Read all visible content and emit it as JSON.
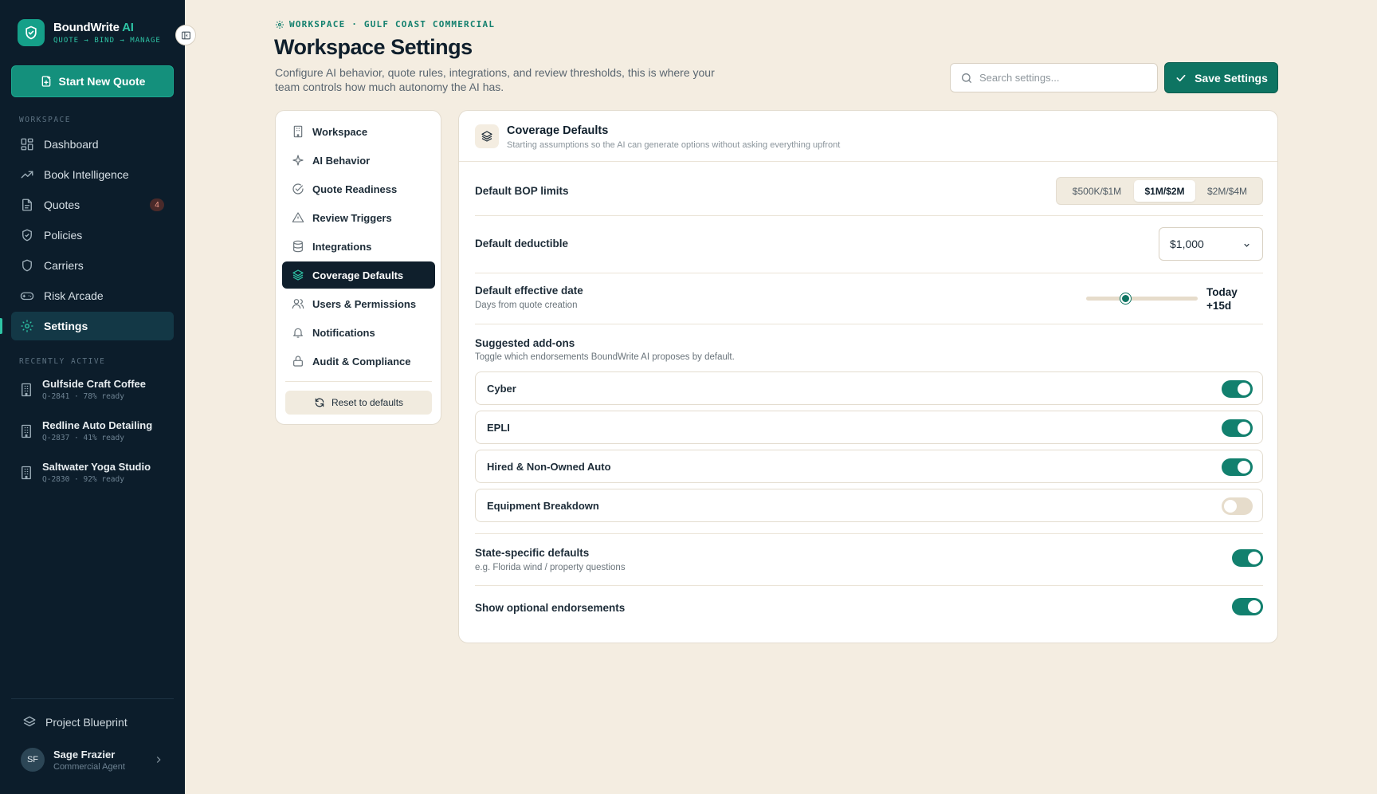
{
  "brand": {
    "name": "BoundWrite",
    "ai": "AI",
    "tagline": "QUOTE → BIND → MANAGE"
  },
  "sidebar": {
    "new_quote": "Start New Quote",
    "workspace_label": "WORKSPACE",
    "items": [
      {
        "label": "Dashboard",
        "icon": "dashboard-icon"
      },
      {
        "label": "Book Intelligence",
        "icon": "trend-icon"
      },
      {
        "label": "Quotes",
        "icon": "document-icon",
        "badge": "4"
      },
      {
        "label": "Policies",
        "icon": "shield-icon"
      },
      {
        "label": "Carriers",
        "icon": "shield-icon"
      },
      {
        "label": "Risk Arcade",
        "icon": "gamepad-icon"
      },
      {
        "label": "Settings",
        "icon": "gear-icon",
        "active": true
      }
    ],
    "recent_label": "RECENTLY ACTIVE",
    "recent": [
      {
        "name": "Gulfside Craft Coffee",
        "meta": "Q-2841 · 78% ready"
      },
      {
        "name": "Redline Auto Detailing",
        "meta": "Q-2837 · 41% ready"
      },
      {
        "name": "Saltwater Yoga Studio",
        "meta": "Q-2830 · 92% ready"
      }
    ],
    "blueprint": "Project Blueprint",
    "user": {
      "initials": "SF",
      "name": "Sage Frazier",
      "role": "Commercial Agent"
    }
  },
  "header": {
    "breadcrumb": "WORKSPACE · GULF COAST COMMERCIAL",
    "title": "Workspace Settings",
    "subtitle": "Configure AI behavior, quote rules, integrations, and review thresholds, this is where your team controls how much autonomy the AI has.",
    "search_placeholder": "Search settings...",
    "save": "Save Settings"
  },
  "menu": {
    "items": [
      {
        "label": "Workspace",
        "icon": "building-icon"
      },
      {
        "label": "AI Behavior",
        "icon": "sparkle-icon"
      },
      {
        "label": "Quote Readiness",
        "icon": "check-circle-icon"
      },
      {
        "label": "Review Triggers",
        "icon": "warning-icon"
      },
      {
        "label": "Integrations",
        "icon": "database-icon"
      },
      {
        "label": "Coverage Defaults",
        "icon": "layers-icon",
        "active": true
      },
      {
        "label": "Users & Permissions",
        "icon": "users-icon"
      },
      {
        "label": "Notifications",
        "icon": "bell-icon"
      },
      {
        "label": "Audit & Compliance",
        "icon": "lock-icon"
      }
    ],
    "reset": "Reset to defaults"
  },
  "panel": {
    "title": "Coverage Defaults",
    "subtitle": "Starting assumptions so the AI can generate options without asking everything upfront",
    "bop": {
      "label": "Default BOP limits",
      "options": [
        "$500K/$1M",
        "$1M/$2M",
        "$2M/$4M"
      ],
      "selected": "$1M/$2M"
    },
    "deductible": {
      "label": "Default deductible",
      "value": "$1,000"
    },
    "effective_date": {
      "label": "Default effective date",
      "hint": "Days from quote creation",
      "value_line1": "Today",
      "value_line2": "+15d",
      "slider_fraction": 0.35
    },
    "addons": {
      "label": "Suggested add-ons",
      "hint": "Toggle which endorsements BoundWrite AI proposes by default.",
      "items": [
        {
          "label": "Cyber",
          "on": true
        },
        {
          "label": "EPLI",
          "on": true
        },
        {
          "label": "Hired & Non-Owned Auto",
          "on": true
        },
        {
          "label": "Equipment Breakdown",
          "on": false
        }
      ]
    },
    "state_defaults": {
      "label": "State-specific defaults",
      "hint": "e.g. Florida wind / property questions",
      "on": true
    },
    "optional_endorsements": {
      "label": "Show optional endorsements",
      "on": true
    }
  },
  "colors": {
    "accent": "#12806e",
    "sidebar": "#0c1d2b",
    "background": "#f4ede1"
  }
}
